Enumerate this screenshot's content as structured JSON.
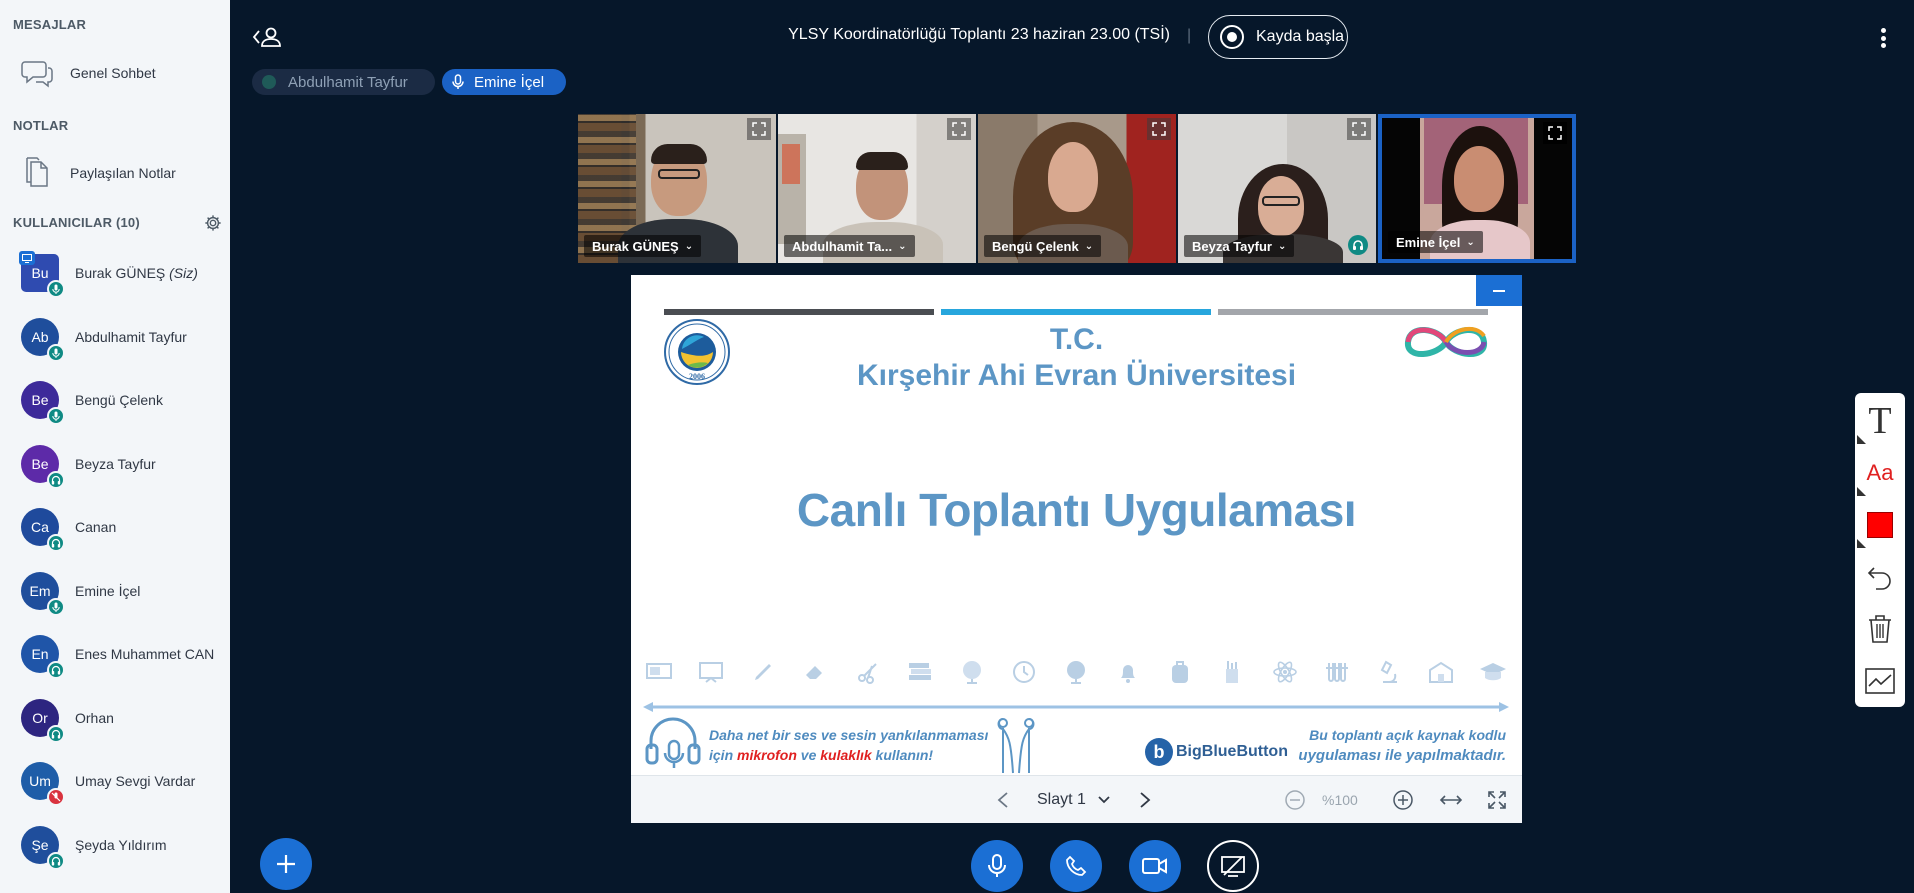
{
  "sidebar": {
    "messages_title": "MESAJLAR",
    "public_chat": "Genel Sohbet",
    "notes_title": "NOTLAR",
    "shared_notes": "Paylaşılan Notlar",
    "users_title": "KULLANICILAR (10)",
    "users": [
      {
        "initials": "Bu",
        "name": "Burak GÜNEŞ",
        "suffix": "(Siz)",
        "color": "#2f4bb0",
        "status": "mic",
        "presenter": true
      },
      {
        "initials": "Ab",
        "name": "Abdulhamit Tayfur",
        "suffix": "",
        "color": "#1f4e9c",
        "status": "mic"
      },
      {
        "initials": "Be",
        "name": "Bengü Çelenk",
        "suffix": "",
        "color": "#3d2a9a",
        "status": "mic"
      },
      {
        "initials": "Be",
        "name": "Beyza Tayfur",
        "suffix": "",
        "color": "#5d2aa8",
        "status": "listen"
      },
      {
        "initials": "Ca",
        "name": "Canan",
        "suffix": "",
        "color": "#1f4a9c",
        "status": "listen"
      },
      {
        "initials": "Em",
        "name": "Emine İçel",
        "suffix": "",
        "color": "#1f4e9c",
        "status": "mic"
      },
      {
        "initials": "En",
        "name": "Enes Muhammet CAN",
        "suffix": "",
        "color": "#1f55a8",
        "status": "listen"
      },
      {
        "initials": "Or",
        "name": "Orhan",
        "suffix": "",
        "color": "#2d2580",
        "status": "listen"
      },
      {
        "initials": "Um",
        "name": "Umay Sevgi Vardar",
        "suffix": "",
        "color": "#1e5da8",
        "status": "muted"
      },
      {
        "initials": "Şe",
        "name": "Şeyda Yıldırım",
        "suffix": "",
        "color": "#1f4e9c",
        "status": "listen"
      }
    ]
  },
  "header": {
    "meeting_title": "YLSY Koordinatörlüğü Toplantı 23 haziran 23.00 (TSİ)",
    "separator": "|",
    "record_label": "Kayda başla"
  },
  "talkers": [
    {
      "name": "Abdulhamit Tayfur",
      "active": false
    },
    {
      "name": "Emine İçel",
      "active": true
    }
  ],
  "webcams": [
    {
      "name": "Burak GÜNEŞ"
    },
    {
      "name": "Abdulhamit Ta..."
    },
    {
      "name": "Bengü Çelenk"
    },
    {
      "name": "Beyza Tayfur"
    },
    {
      "name": "Emine İçel"
    }
  ],
  "slide": {
    "tc": "T.C.",
    "university": "Kırşehir Ahi Evran Üniversitesi",
    "main_title": "Canlı Toplantı Uygulaması",
    "seal_year": "2006",
    "tip_line1": "Daha net bir ses ve sesin yankılanmaması",
    "tip_line2_a": "için ",
    "tip_line2_mic": "mikrofon",
    "tip_line2_and": " ve ",
    "tip_line2_hp": "kulaklık",
    "tip_line2_b": " kullanın!",
    "bbb_line1": "Bu toplantı açık kaynak kodlu",
    "bbb_line2": "uygulaması ile yapılmaktadır.",
    "bbb_brand": "BigBlueButton"
  },
  "slide_toolbar": {
    "slide_label": "Slayt 1",
    "zoom": "%100"
  },
  "colors": {
    "accent": "#1b6fd4",
    "background": "#06172a",
    "slide_text": "#5c96c5"
  }
}
